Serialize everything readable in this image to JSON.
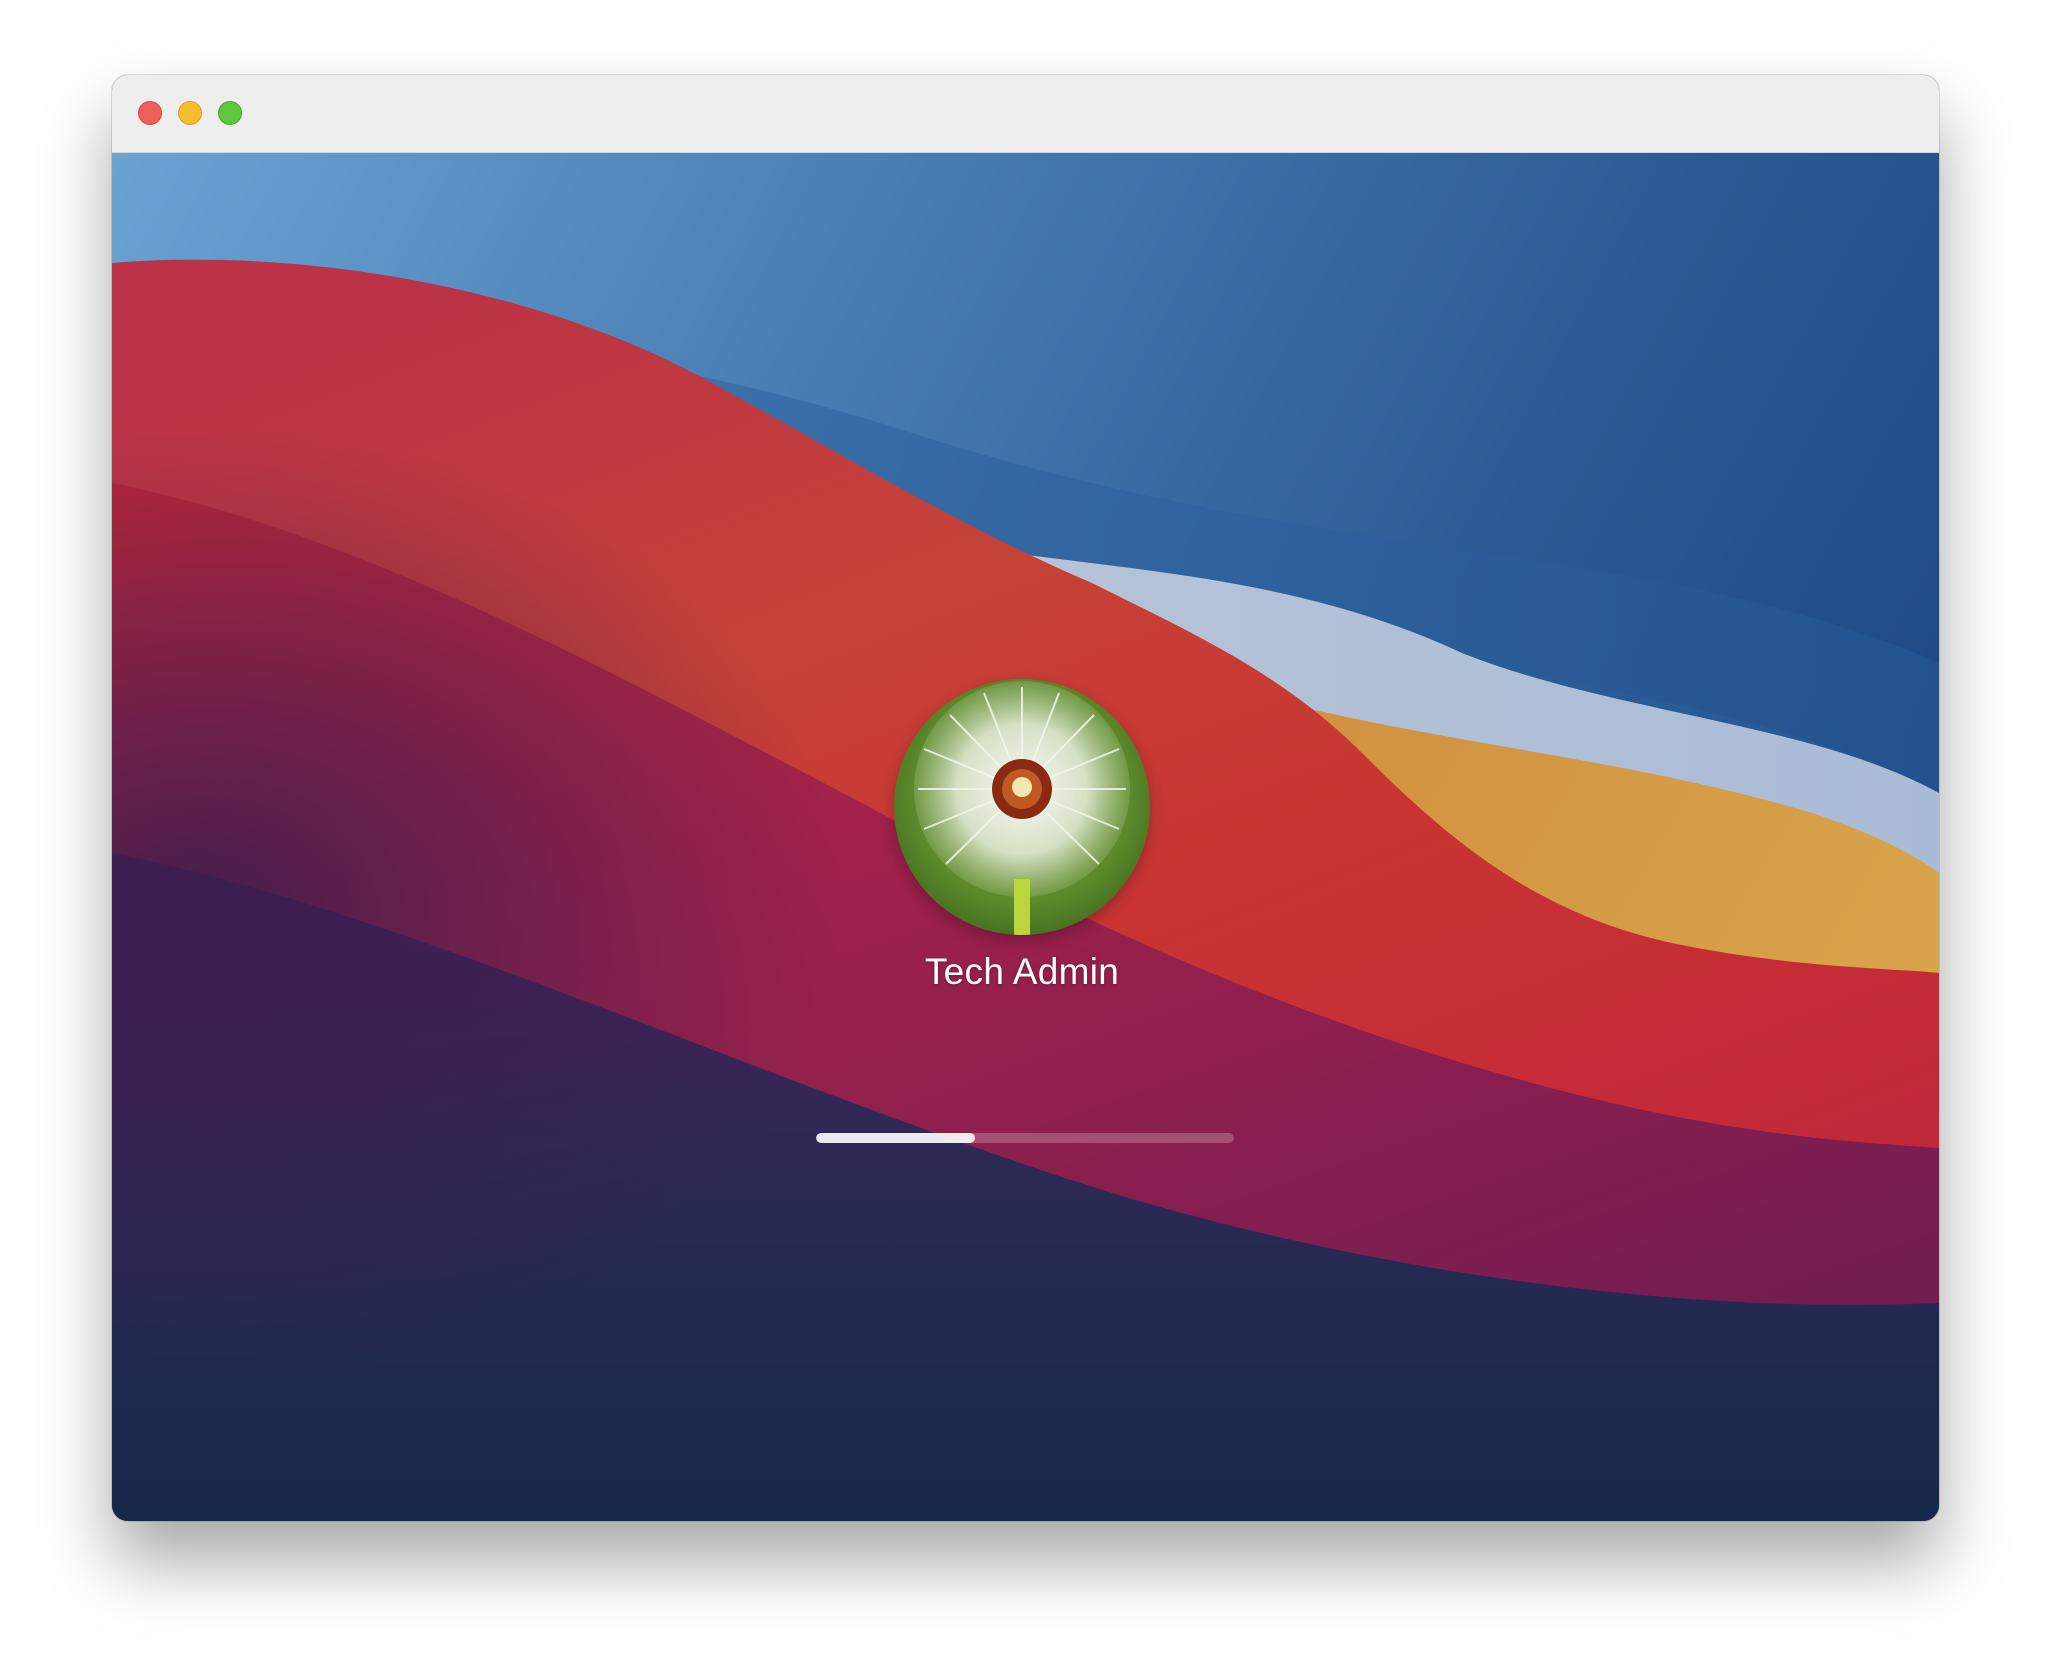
{
  "window": {
    "controls": {
      "close_icon": "close-traffic-light",
      "minimize_icon": "minimize-traffic-light",
      "maximize_icon": "zoom-traffic-light"
    }
  },
  "login": {
    "user_name": "Tech Admin",
    "avatar_icon": "dandelion-avatar",
    "progress": 0.38
  },
  "colors": {
    "close": "#ee5f58",
    "minimize": "#f8bd2e",
    "maximize": "#5fc83f",
    "wallpaper_sky": "#3e74ad",
    "wallpaper_red": "#c93432",
    "wallpaper_orange": "#cf8a3d",
    "wallpaper_navy": "#1b2a4e"
  }
}
